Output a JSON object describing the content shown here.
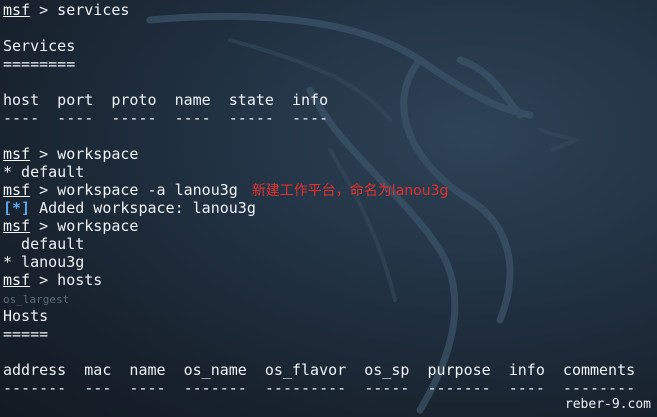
{
  "terminal": {
    "prompt": "msf",
    "lines": [
      {
        "kind": "cmd",
        "text": " > services"
      },
      {
        "kind": "blank",
        "text": ""
      },
      {
        "kind": "out",
        "text": "Services"
      },
      {
        "kind": "out",
        "text": "========"
      },
      {
        "kind": "blank",
        "text": ""
      },
      {
        "kind": "out",
        "text": "host  port  proto  name  state  info"
      },
      {
        "kind": "out",
        "text": "----  ----  -----  ----  -----  ----"
      },
      {
        "kind": "blank",
        "text": ""
      },
      {
        "kind": "cmd",
        "text": " > workspace"
      },
      {
        "kind": "out",
        "text": "* default"
      },
      {
        "kind": "cmd",
        "text": " > workspace -a lanou3g",
        "annotation": "新建工作平台，命名为lanou3g"
      },
      {
        "kind": "info",
        "tag": "[*]",
        "text": " Added workspace: lanou3g"
      },
      {
        "kind": "cmd",
        "text": " > workspace"
      },
      {
        "kind": "out",
        "text": "  default"
      },
      {
        "kind": "out",
        "text": "* lanou3g"
      },
      {
        "kind": "cmd",
        "text": " > hosts"
      },
      {
        "kind": "ghost",
        "text": "os_largest"
      },
      {
        "kind": "out",
        "text": "Hosts"
      },
      {
        "kind": "out",
        "text": "====="
      },
      {
        "kind": "blank",
        "text": ""
      },
      {
        "kind": "out",
        "text": "address  mac  name  os_name  os_flavor  os_sp  purpose  info  comments"
      },
      {
        "kind": "out",
        "text": "-------  ---  ----  -------  ---------  -----  -------  ----  --------"
      }
    ]
  },
  "watermark": "reber-9.com",
  "colors": {
    "background": "#1b2733",
    "text": "#eef2f5",
    "info_tag": "#5aa9ee",
    "annotation": "#e0312e"
  }
}
